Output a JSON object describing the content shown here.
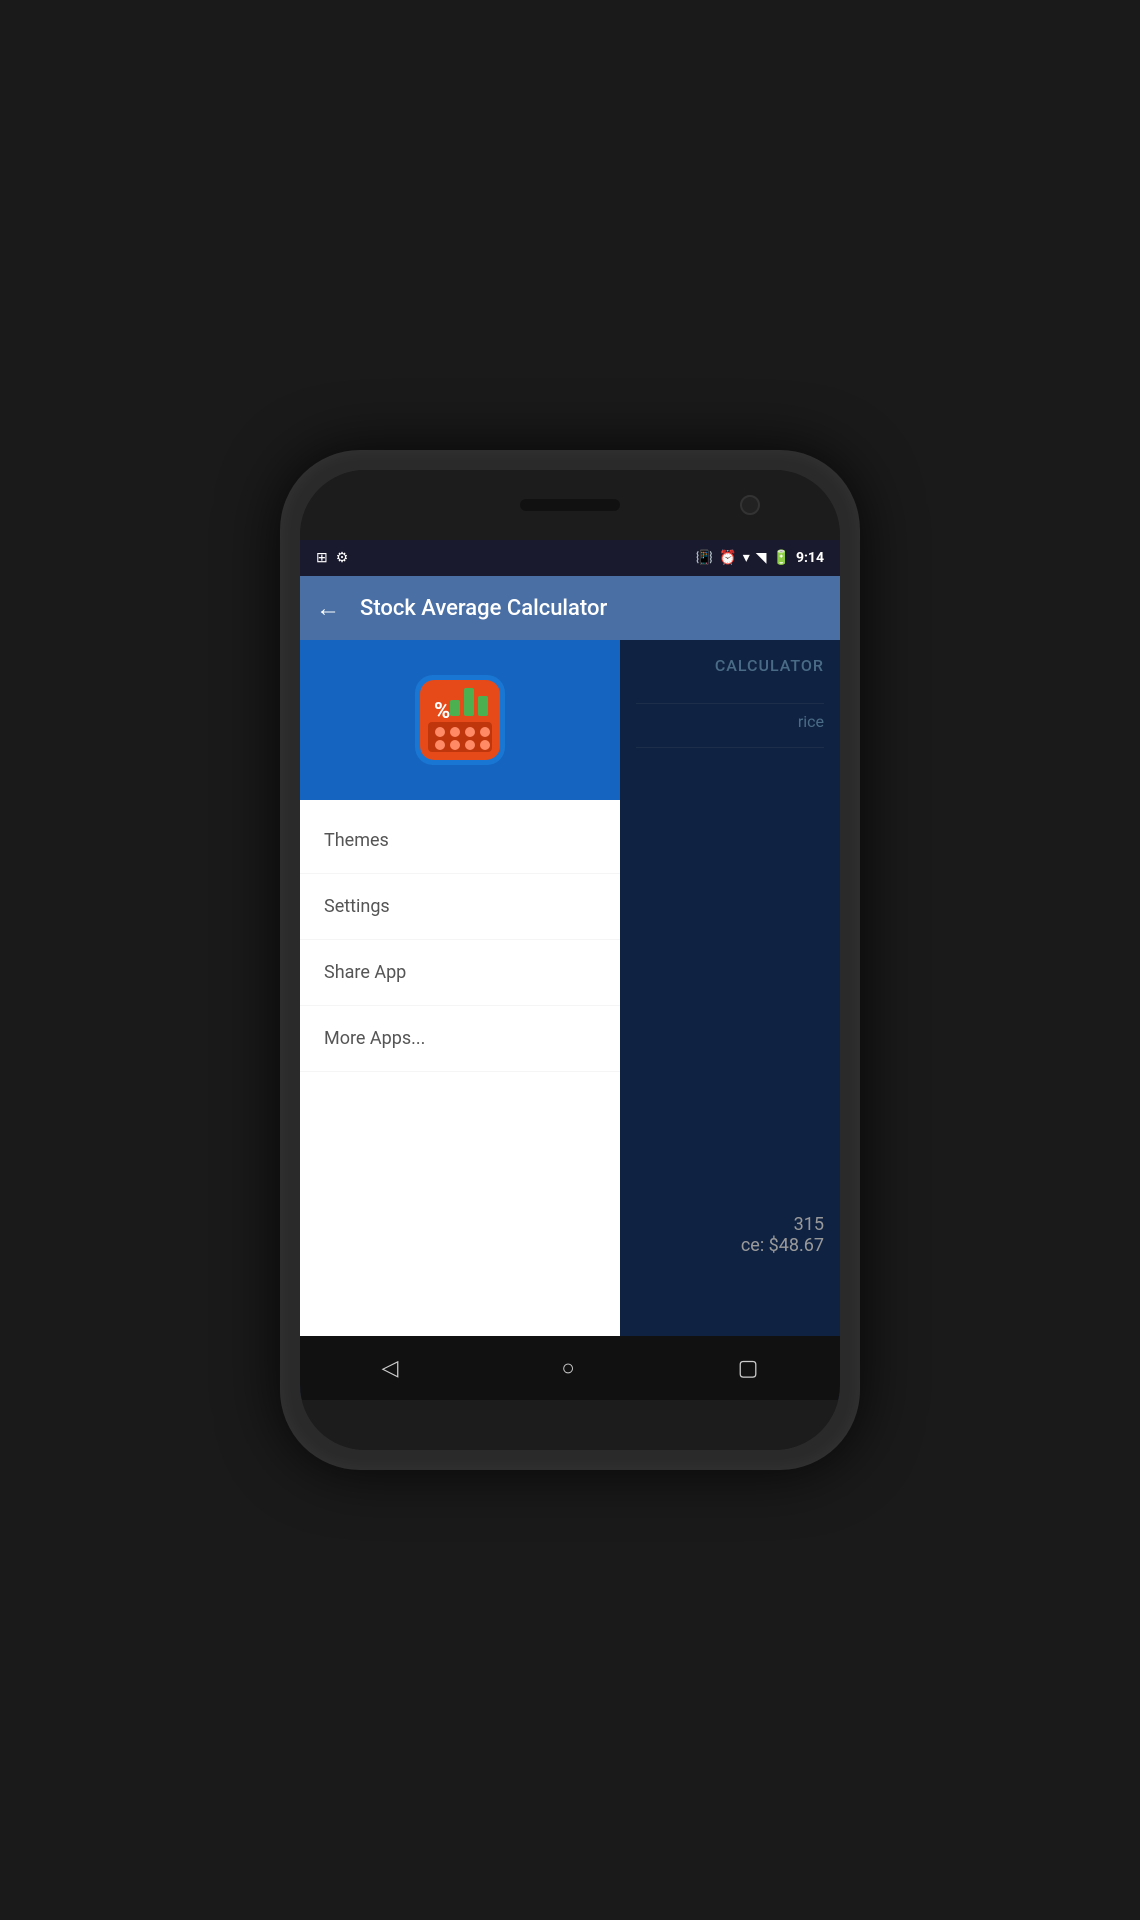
{
  "status_bar": {
    "time": "9:14",
    "icons_left": [
      "image-icon",
      "android-icon"
    ],
    "icons_right": [
      "vibrate-icon",
      "alarm-icon",
      "wifi-icon",
      "signal-icon",
      "battery-icon"
    ]
  },
  "app_bar": {
    "title": "Stock Average Calculator",
    "back_label": "←"
  },
  "drawer": {
    "menu_items": [
      {
        "label": "Themes",
        "id": "themes"
      },
      {
        "label": "Settings",
        "id": "settings"
      },
      {
        "label": "Share App",
        "id": "share-app"
      },
      {
        "label": "More Apps...",
        "id": "more-apps"
      }
    ]
  },
  "background": {
    "title": "CALCULATOR",
    "price_label": "rice",
    "bottom_number": "315",
    "bottom_price": "ce: $48.67"
  },
  "nav_bar": {
    "back": "◁",
    "home": "○",
    "recent": "▢"
  }
}
